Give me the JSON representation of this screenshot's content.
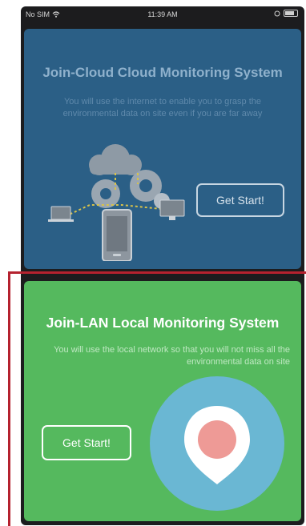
{
  "status_bar": {
    "carrier": "No SIM",
    "time": "11:39 AM"
  },
  "cloud_card": {
    "title": "Join-Cloud Cloud Monitoring System",
    "description": "You will use the internet to enable you to grasp the environmental data on site even if you are far away",
    "button_label": "Get Start!",
    "illustration_icon": "cloud-network-icon"
  },
  "lan_card": {
    "title": "Join-LAN Local Monitoring System",
    "description": "You will use the local network so that you will not miss all the environmental data on site",
    "button_label": "Get Start!",
    "illustration_icon": "location-pin-icon"
  },
  "colors": {
    "cloud_card_bg": "#2b5f86",
    "lan_card_bg": "#55b95e",
    "pin_circle": "#6ab7d3",
    "pin_center": "#ee9a96",
    "highlight_border": "#b5222f"
  }
}
